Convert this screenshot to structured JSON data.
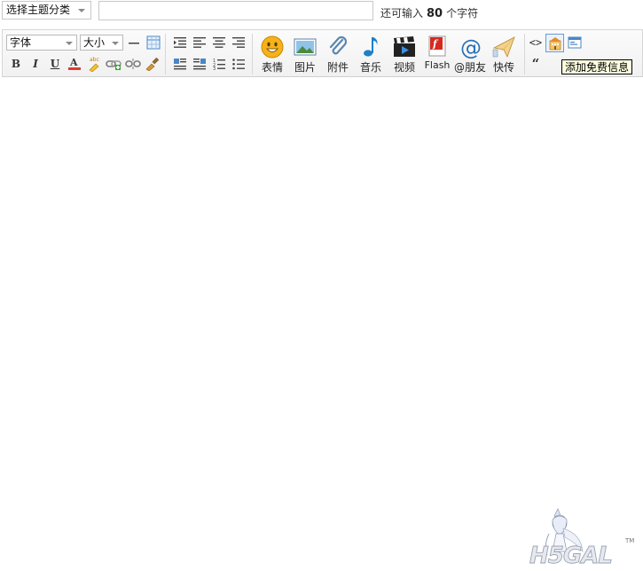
{
  "topic": {
    "select_label": "选择主题分类"
  },
  "subject": {
    "value": "",
    "placeholder": ""
  },
  "counter": {
    "prefix": "还可输入",
    "count": "80",
    "suffix": "个字符"
  },
  "toolbar": {
    "font_select": "字体",
    "size_select": "大小",
    "media": {
      "emoticon": "表情",
      "image": "图片",
      "attachment": "附件",
      "music": "音乐",
      "video": "视频",
      "flash": "Flash",
      "mention": "@朋友",
      "quick_post": "快传"
    },
    "quote_glyph": "“",
    "code_glyph": "<>"
  },
  "tooltip": {
    "text": "添加免费信息"
  },
  "watermark": {
    "brand": "H5GAL",
    "tm": "TM"
  },
  "colors": {
    "accent": "#6b9bd5",
    "tooltip_bg": "#ffffe1",
    "toolbar_border": "#d6d6d6"
  }
}
